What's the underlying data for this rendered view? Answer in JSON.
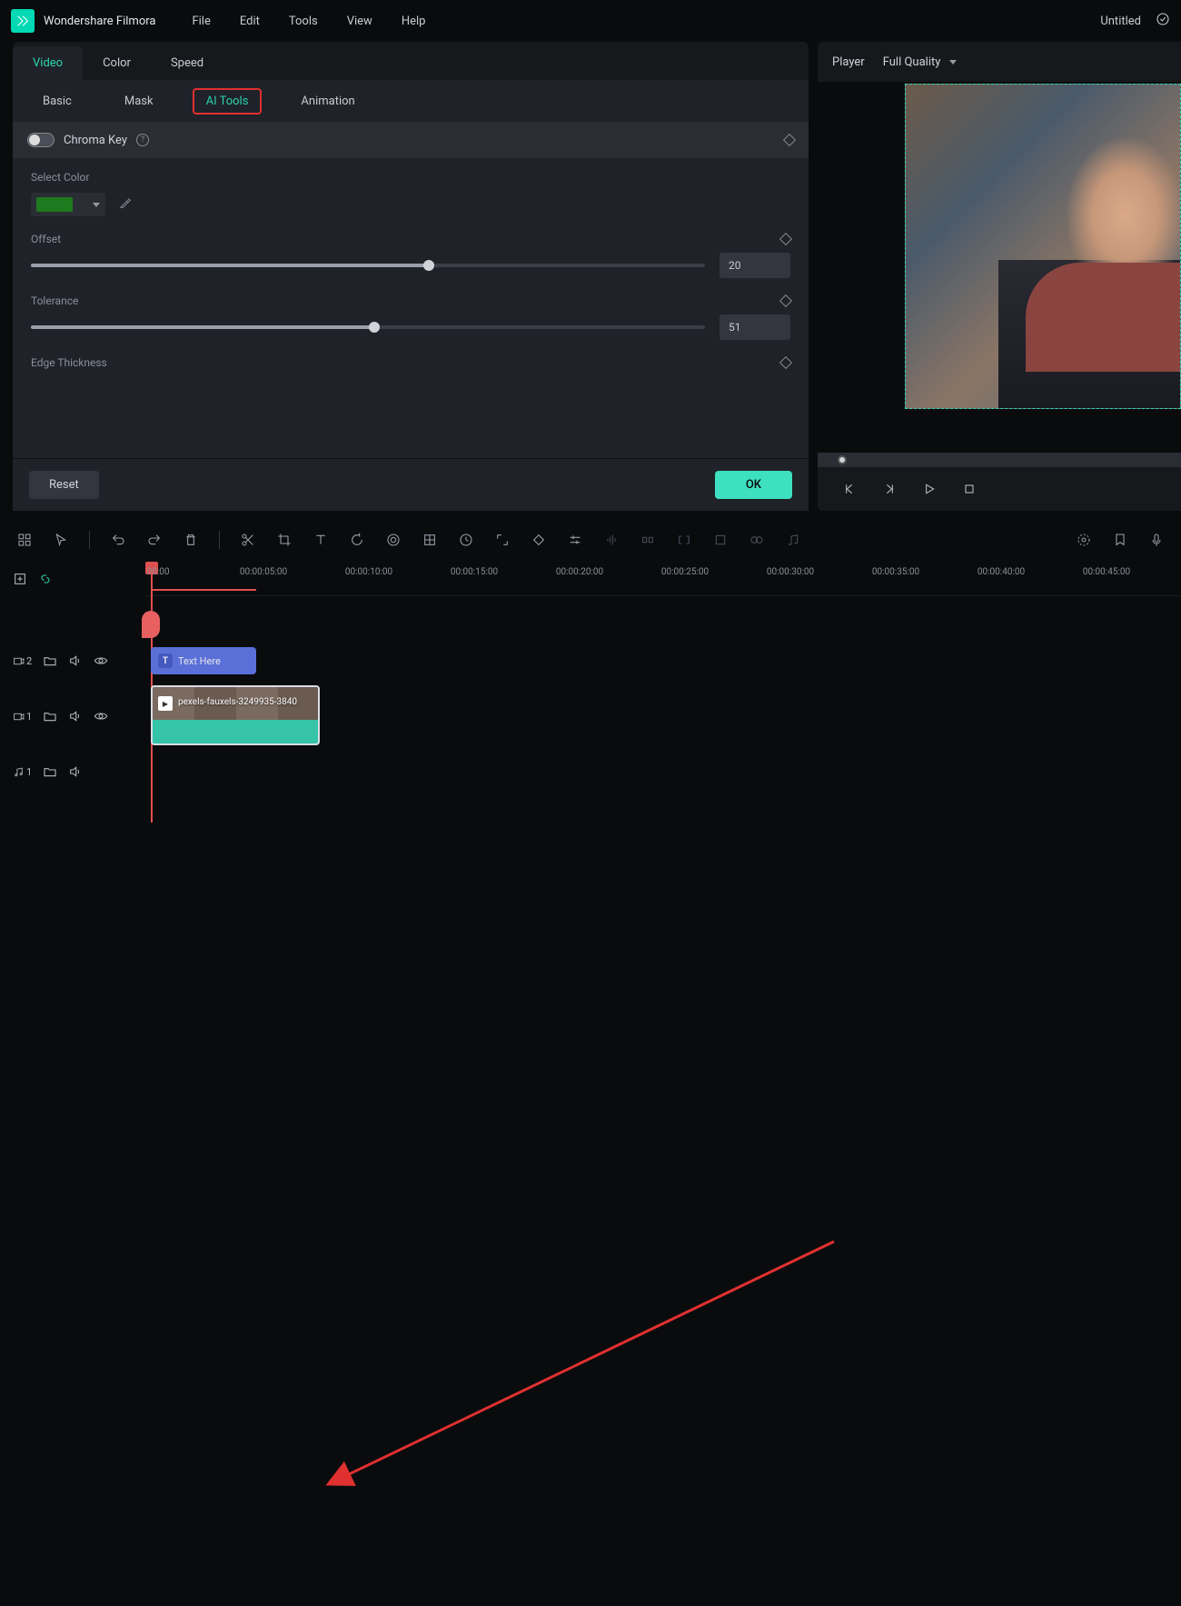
{
  "app": {
    "name": "Wondershare Filmora",
    "project": "Untitled"
  },
  "menu": {
    "file": "File",
    "edit": "Edit",
    "tools": "Tools",
    "view": "View",
    "help": "Help"
  },
  "primary_tabs": {
    "video": "Video",
    "color": "Color",
    "speed": "Speed"
  },
  "sub_tabs": {
    "basic": "Basic",
    "mask": "Mask",
    "ai_tools": "AI Tools",
    "animation": "Animation"
  },
  "chroma": {
    "title": "Chroma Key",
    "select_color_label": "Select Color",
    "offset_label": "Offset",
    "offset_value": "20",
    "tolerance_label": "Tolerance",
    "tolerance_value": "51",
    "edge_label": "Edge Thickness",
    "reset": "Reset",
    "ok": "OK"
  },
  "player": {
    "label": "Player",
    "quality": "Full Quality"
  },
  "timeline": {
    "labels": [
      "00:00",
      "00:00:05:00",
      "00:00:10:00",
      "00:00:15:00",
      "00:00:20:00",
      "00:00:25:00",
      "00:00:30:00",
      "00:00:35:00",
      "00:00:40:00",
      "00:00:45:00"
    ],
    "text_clip": "Text Here",
    "video_clip": "pexels-fauxels-3249935-3840",
    "track_video2": "2",
    "track_video1": "1",
    "track_audio1": "1"
  }
}
